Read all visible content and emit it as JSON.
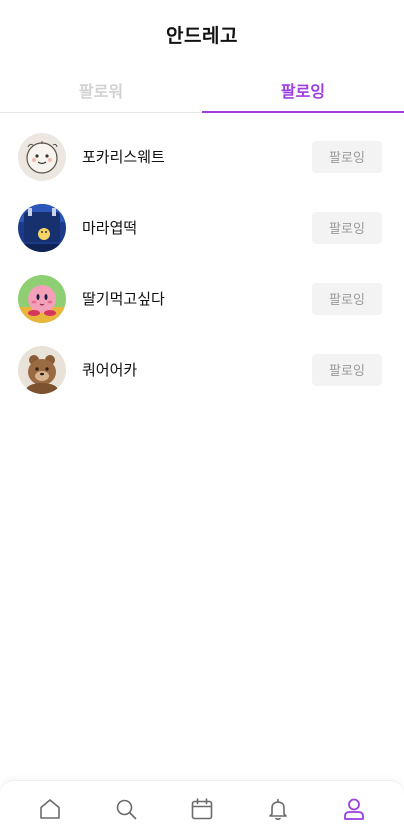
{
  "header": {
    "title": "안드레고"
  },
  "tabs": [
    {
      "label": "팔로워",
      "active": false
    },
    {
      "label": "팔로잉",
      "active": true
    }
  ],
  "following": [
    {
      "username": "포카리스웨트",
      "button_label": "팔로잉"
    },
    {
      "username": "마라엽떡",
      "button_label": "팔로잉"
    },
    {
      "username": "딸기먹고싶다",
      "button_label": "팔로잉"
    },
    {
      "username": "쿼어어카",
      "button_label": "팔로잉"
    }
  ],
  "bottom_nav": [
    {
      "icon": "home-icon",
      "active": false
    },
    {
      "icon": "search-icon",
      "active": false
    },
    {
      "icon": "calendar-icon",
      "active": false
    },
    {
      "icon": "bell-icon",
      "active": false
    },
    {
      "icon": "profile-icon",
      "active": true
    }
  ],
  "colors": {
    "accent": "#9b3fe0",
    "inactive_tab": "#d2d2d2",
    "button_bg": "#f3f3f3",
    "button_text": "#9a9a9a",
    "nav_icon": "#6b6b6b"
  }
}
